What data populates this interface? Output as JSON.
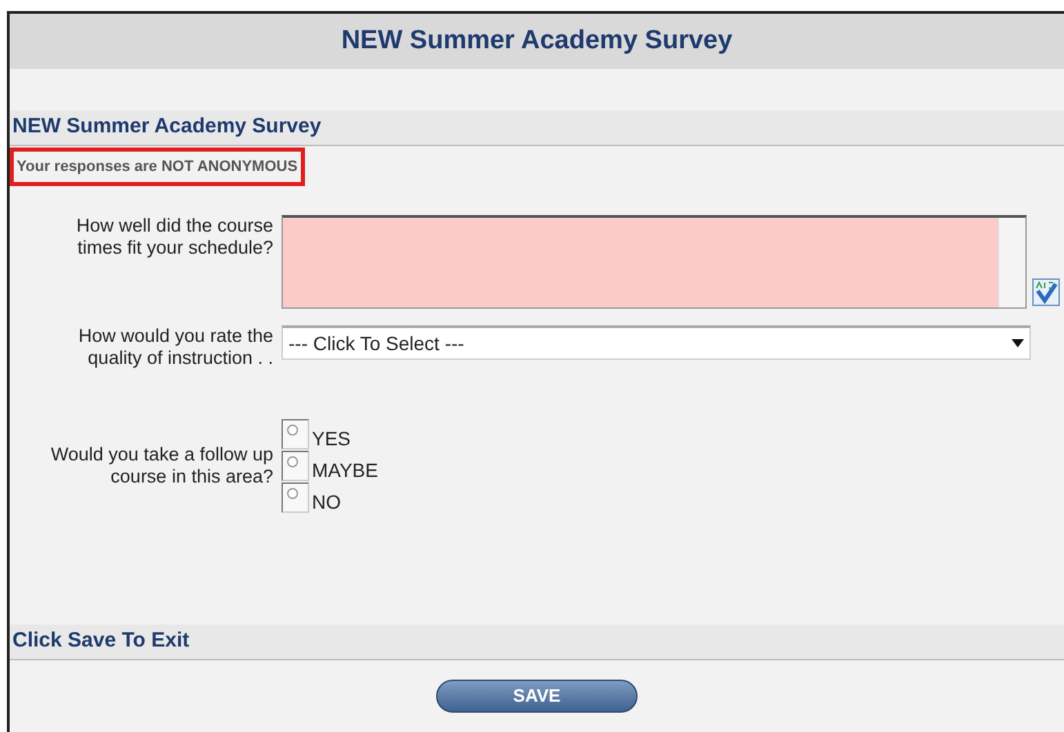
{
  "page_title": "NEW Summer Academy Survey",
  "section_title": "NEW Summer Academy Survey",
  "notice": {
    "text": "Your responses are NOT ANONYMOUS",
    "highlighted": true
  },
  "questions": [
    {
      "kind": "textarea",
      "label": "How well did the course times fit your schedule?",
      "required": true
    },
    {
      "kind": "select",
      "label": "How would you rate the quality of instruction . .",
      "value": "--- Click To Select ---"
    },
    {
      "kind": "radio",
      "label": "Would you take a follow up course in this area?",
      "options": [
        {
          "label": "YES",
          "selected": false
        },
        {
          "label": "MAYBE",
          "selected": false
        },
        {
          "label": "NO",
          "selected": false
        }
      ]
    }
  ],
  "footer_title": "Click Save To Exit",
  "save_button": "SAVE"
}
